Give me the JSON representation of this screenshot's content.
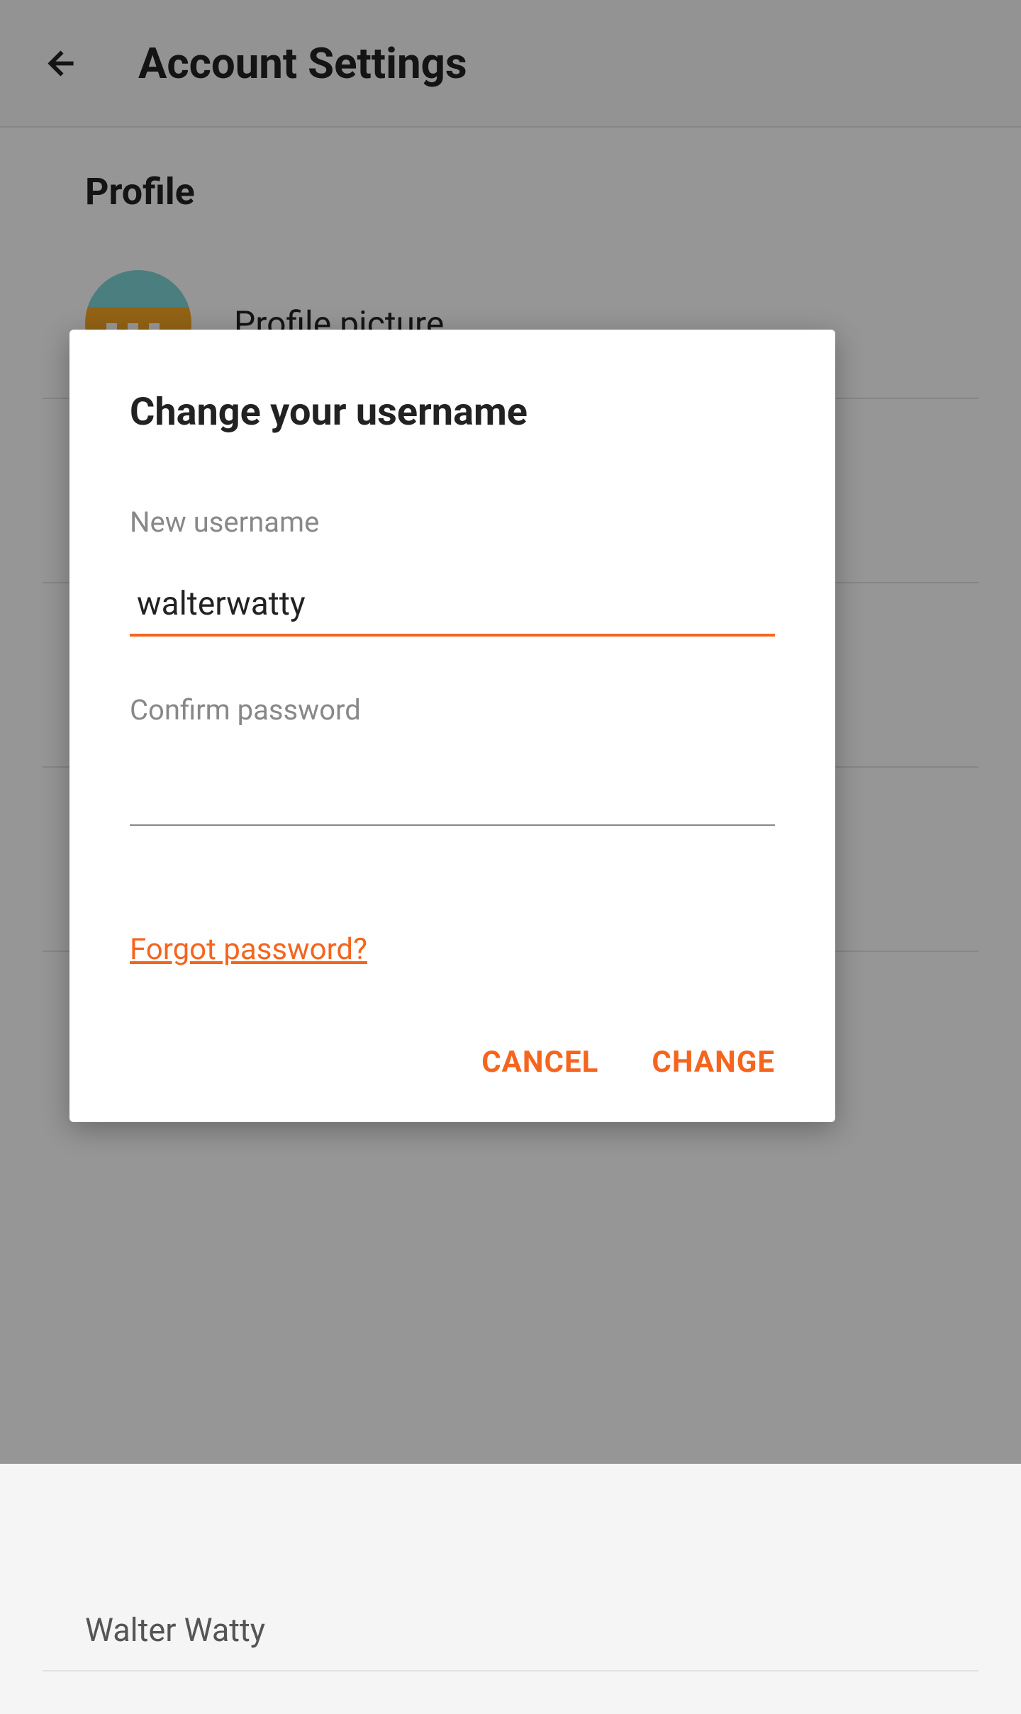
{
  "header": {
    "title": "Account Settings"
  },
  "profile": {
    "section_title": "Profile",
    "picture_label": "Profile picture",
    "fullname": "Walter Watty"
  },
  "dialog": {
    "title": "Change your username",
    "new_username_label": "New username",
    "new_username_value": "walterwatty",
    "confirm_password_label": "Confirm password",
    "confirm_password_value": "",
    "forgot_link": "Forgot password?",
    "cancel_button": "CANCEL",
    "change_button": "CHANGE"
  },
  "colors": {
    "accent": "#f5651e",
    "text_primary": "#222",
    "text_secondary": "#888"
  }
}
